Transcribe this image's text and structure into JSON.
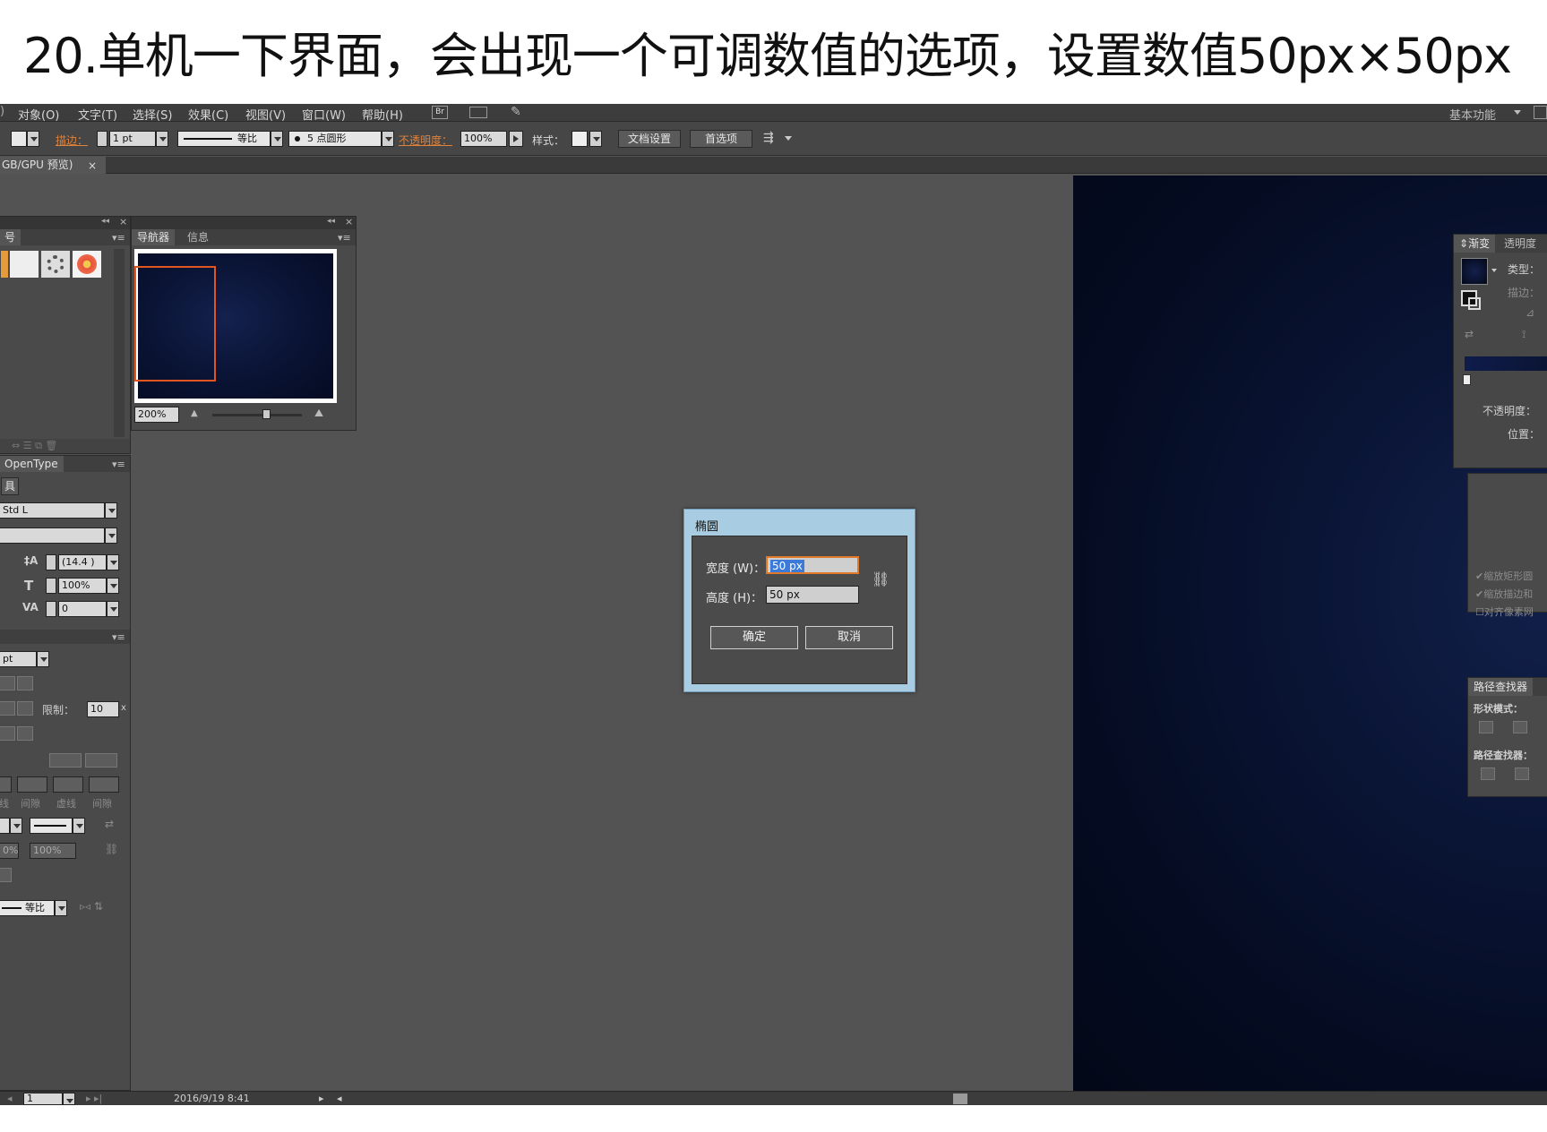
{
  "caption": "20.单机一下界面，会出现一个可调数值的选项，设置数值50px×50px",
  "menu": [
    "对象(O)",
    "文字(T)",
    "选择(S)",
    "效果(C)",
    "视图(V)",
    "窗口(W)",
    "帮助(H)"
  ],
  "workspace": "基本功能",
  "control_bar": {
    "stroke_label": "描边：",
    "stroke_value": "1 pt",
    "stroke_profile": "等比",
    "brush": "5 点圆形",
    "opacity_label": "不透明度：",
    "opacity_value": "100%",
    "style_label": "样式：",
    "doc_setup": "文档设置",
    "preferences": "首选项"
  },
  "doc_tab": "GB/GPU 预览)",
  "left_panel": {
    "top_tab": "号",
    "opentype_tab": "OpenType",
    "tool_label": "具",
    "font_name": "Std L",
    "leading": "(14.4 )",
    "scale": "100%",
    "tracking": "0",
    "stroke_unit": "pt",
    "limit_label": "限制：",
    "limit_value": "10",
    "dash_labels": [
      "线",
      "间隙",
      "虚线",
      "间隙"
    ],
    "pct_a": "0%",
    "pct_b": "100%",
    "profile": "等比"
  },
  "navigator": {
    "tabs": [
      "导航器",
      "信息"
    ],
    "zoom": "200%"
  },
  "dialog": {
    "title": "椭圆",
    "width_label": "宽度 (W)：",
    "width_value": "50 px",
    "height_label": "高度 (H)：",
    "height_value": "50 px",
    "ok": "确定",
    "cancel": "取消"
  },
  "right_panel": {
    "tabs": [
      "渐变",
      "透明度"
    ],
    "type_label": "类型：",
    "stroke_label": "描边：",
    "opacity_label": "不透明度：",
    "position_label": "位置：",
    "checks": [
      "缩放矩形圆",
      "缩放描边和",
      "对齐像素网"
    ],
    "pathfinder": "路径查找器",
    "shape_modes": "形状模式：",
    "pathfinders": "路径查找器："
  },
  "status": {
    "page": "1",
    "datetime": "2016/9/19 8:41"
  }
}
